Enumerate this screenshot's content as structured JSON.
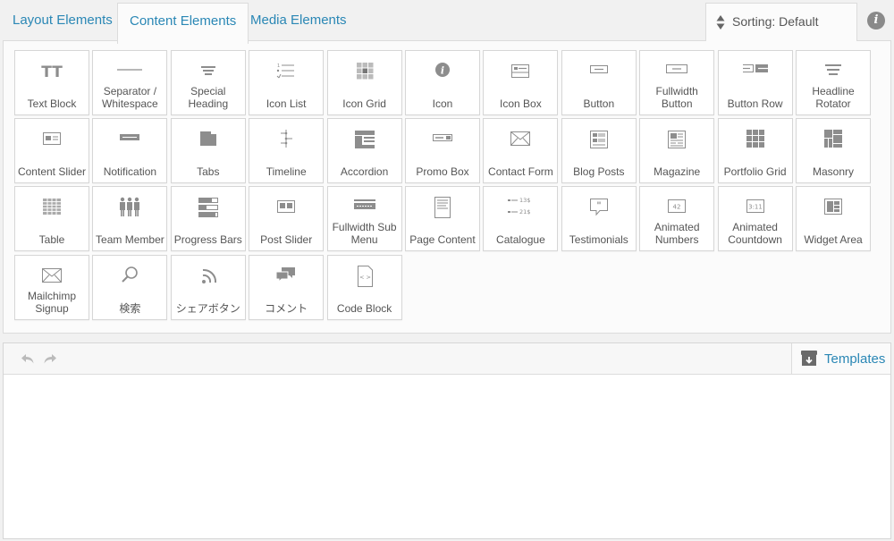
{
  "tabs": [
    {
      "label": "Layout Elements",
      "active": false
    },
    {
      "label": "Content Elements",
      "active": true
    },
    {
      "label": "Media Elements",
      "active": false
    }
  ],
  "sorting": {
    "label": "Sorting: Default"
  },
  "info": {
    "glyph": "i"
  },
  "elements": [
    {
      "label": "Text Block",
      "icon": "text-block-icon"
    },
    {
      "label": "Separator / Whitespace",
      "icon": "separator-icon"
    },
    {
      "label": "Special Heading",
      "icon": "special-heading-icon"
    },
    {
      "label": "Icon List",
      "icon": "icon-list-icon"
    },
    {
      "label": "Icon Grid",
      "icon": "icon-grid-icon"
    },
    {
      "label": "Icon",
      "icon": "info-circle-icon"
    },
    {
      "label": "Icon Box",
      "icon": "icon-box-icon"
    },
    {
      "label": "Button",
      "icon": "button-icon"
    },
    {
      "label": "Fullwidth Button",
      "icon": "fullwidth-button-icon"
    },
    {
      "label": "Button Row",
      "icon": "button-row-icon"
    },
    {
      "label": "Headline Rotator",
      "icon": "headline-rotator-icon"
    },
    {
      "label": "Content Slider",
      "icon": "content-slider-icon"
    },
    {
      "label": "Notification",
      "icon": "notification-icon"
    },
    {
      "label": "Tabs",
      "icon": "tabs-icon"
    },
    {
      "label": "Timeline",
      "icon": "timeline-icon"
    },
    {
      "label": "Accordion",
      "icon": "accordion-icon"
    },
    {
      "label": "Promo Box",
      "icon": "promo-box-icon"
    },
    {
      "label": "Contact Form",
      "icon": "envelope-icon"
    },
    {
      "label": "Blog Posts",
      "icon": "blog-posts-icon"
    },
    {
      "label": "Magazine",
      "icon": "magazine-icon"
    },
    {
      "label": "Portfolio Grid",
      "icon": "portfolio-grid-icon"
    },
    {
      "label": "Masonry",
      "icon": "masonry-icon"
    },
    {
      "label": "Table",
      "icon": "table-icon"
    },
    {
      "label": "Team Member",
      "icon": "team-member-icon"
    },
    {
      "label": "Progress Bars",
      "icon": "progress-bars-icon"
    },
    {
      "label": "Post Slider",
      "icon": "post-slider-icon"
    },
    {
      "label": "Fullwidth Sub Menu",
      "icon": "sub-menu-icon"
    },
    {
      "label": "Page Content",
      "icon": "page-content-icon"
    },
    {
      "label": "Catalogue",
      "icon": "catalogue-icon",
      "prices": [
        "13$",
        "21$"
      ]
    },
    {
      "label": "Testimonials",
      "icon": "quote-bubble-icon"
    },
    {
      "label": "Animated Numbers",
      "icon": "animated-numbers-icon",
      "value": "42"
    },
    {
      "label": "Animated Countdown",
      "icon": "countdown-icon",
      "value": "3:11"
    },
    {
      "label": "Widget Area",
      "icon": "widget-area-icon"
    },
    {
      "label": "Mailchimp Signup",
      "icon": "envelope-icon"
    },
    {
      "label": "検索",
      "icon": "search-icon"
    },
    {
      "label": "シェアボタン",
      "icon": "rss-icon"
    },
    {
      "label": "コメント",
      "icon": "comments-icon"
    },
    {
      "label": "Code Block",
      "icon": "code-block-icon",
      "code": "< >"
    }
  ],
  "toolbar": {
    "undo_icon": "undo-icon",
    "redo_icon": "redo-icon",
    "templates_label": "Templates"
  },
  "colors": {
    "accent": "#2a87b5",
    "icon": "#8d8d8d",
    "border": "#d6d6d6"
  }
}
